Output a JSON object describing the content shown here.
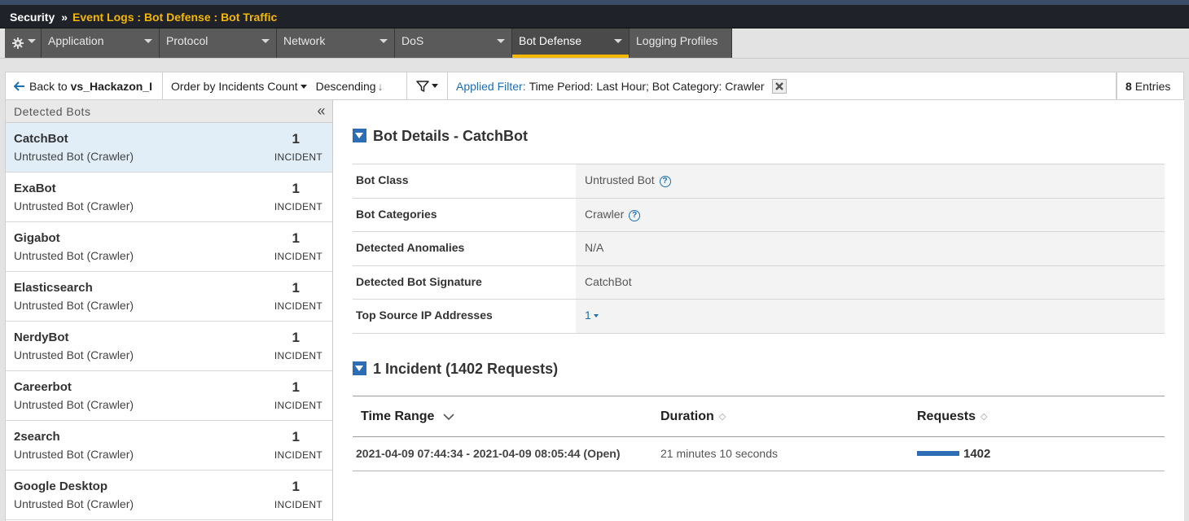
{
  "breadcrumb": {
    "section": "Security",
    "separator": "»",
    "path": "Event Logs : Bot Defense : Bot Traffic"
  },
  "tabs": [
    {
      "label": "Application"
    },
    {
      "label": "Protocol"
    },
    {
      "label": "Network"
    },
    {
      "label": "DoS"
    },
    {
      "label": "Bot Defense",
      "active": true
    },
    {
      "label": "Logging Profiles"
    }
  ],
  "toolbar": {
    "back_prefix": "Back to ",
    "back_target": "vs_Hackazon_I",
    "order_by": "Order by Incidents Count",
    "direction": "Descending",
    "direction_arrow": "↓",
    "applied_filter_label": "Applied Filter:",
    "applied_filter_value": "Time Period: Last Hour; Bot Category: Crawler",
    "entries_count": "8",
    "entries_label": "Entries"
  },
  "left_panel": {
    "title": "Detected Bots",
    "collapse_glyph": "«",
    "bots": [
      {
        "name": "CatchBot",
        "category": "Untrusted Bot (Crawler)",
        "count": "1",
        "unit": "INCIDENT",
        "selected": true
      },
      {
        "name": "ExaBot",
        "category": "Untrusted Bot (Crawler)",
        "count": "1",
        "unit": "INCIDENT"
      },
      {
        "name": "Gigabot",
        "category": "Untrusted Bot (Crawler)",
        "count": "1",
        "unit": "INCIDENT"
      },
      {
        "name": "Elasticsearch",
        "category": "Untrusted Bot (Crawler)",
        "count": "1",
        "unit": "INCIDENT"
      },
      {
        "name": "NerdyBot",
        "category": "Untrusted Bot (Crawler)",
        "count": "1",
        "unit": "INCIDENT"
      },
      {
        "name": "Careerbot",
        "category": "Untrusted Bot (Crawler)",
        "count": "1",
        "unit": "INCIDENT"
      },
      {
        "name": "2search",
        "category": "Untrusted Bot (Crawler)",
        "count": "1",
        "unit": "INCIDENT"
      },
      {
        "name": "Google Desktop",
        "category": "Untrusted Bot (Crawler)",
        "count": "1",
        "unit": "INCIDENT"
      }
    ]
  },
  "details": {
    "title": "Bot Details - CatchBot",
    "rows": [
      {
        "label": "Bot Class",
        "value": "Untrusted Bot",
        "help": true
      },
      {
        "label": "Bot Categories",
        "value": "Crawler",
        "help": true
      },
      {
        "label": "Detected Anomalies",
        "value": "N/A"
      },
      {
        "label": "Detected Bot Signature",
        "value": "CatchBot"
      },
      {
        "label": "Top Source IP Addresses",
        "value": "1",
        "dropdown": true
      }
    ]
  },
  "incidents": {
    "title": "1 Incident (1402 Requests)",
    "columns": [
      "Time Range",
      "Duration",
      "Requests"
    ],
    "rows": [
      {
        "time_range": "2021-04-09 07:44:34 - 2021-04-09 08:05:44 (Open)",
        "duration": "21 minutes 10 seconds",
        "requests": "1402"
      }
    ]
  },
  "colors": {
    "accent_yellow": "#f5b800",
    "link_blue": "#1a6fb5",
    "selected_row": "#e1eef8",
    "topbar": "#1f2229",
    "tab_bg": "#5a5a5a"
  },
  "icons": {
    "gear": "gear-icon",
    "back": "arrow-left-icon",
    "funnel": "filter-icon",
    "clear": "close-icon",
    "collapse": "double-chevron-left-icon",
    "toggle": "triangle-down-icon",
    "help": "question-circle-icon"
  }
}
